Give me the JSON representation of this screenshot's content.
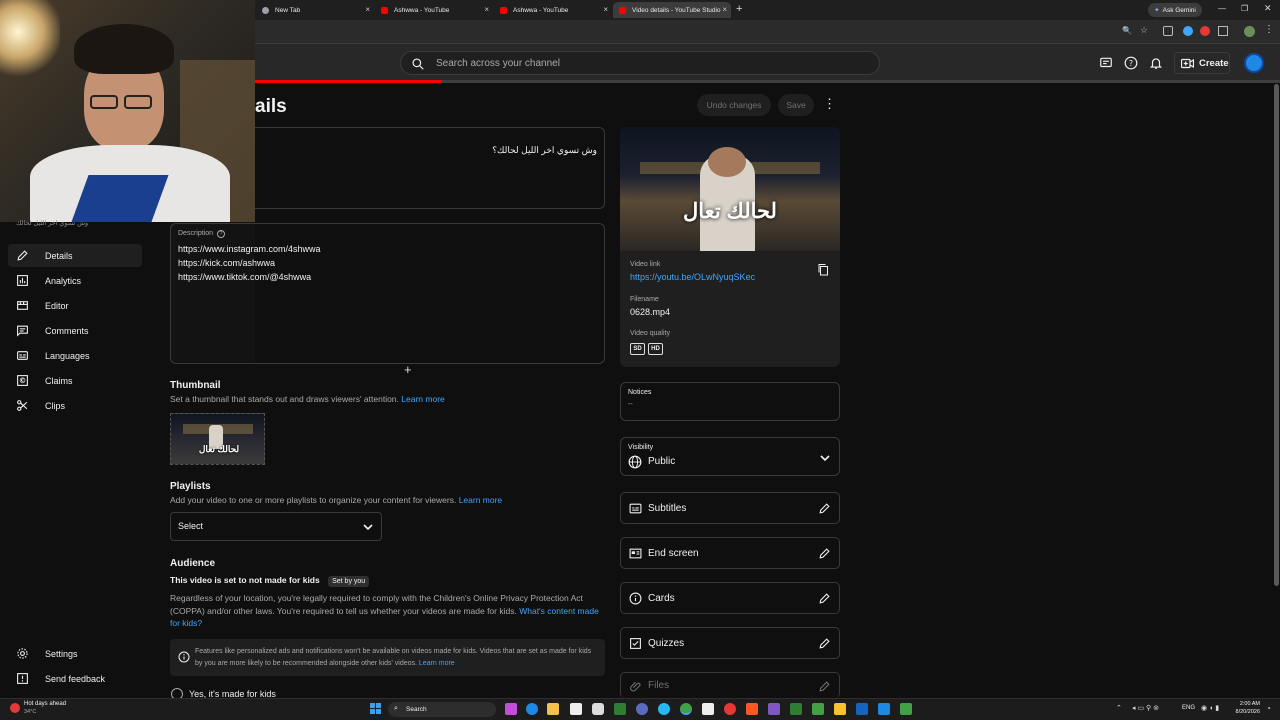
{
  "browser": {
    "tabs": [
      {
        "label": "New Tab",
        "favicon_color": "#9aa0a6"
      },
      {
        "label": "Ashwwa - YouTube",
        "favicon_color": "#ff0000"
      },
      {
        "label": "Ashwwa - YouTube",
        "favicon_color": "#ff0000"
      },
      {
        "label": "Video details - YouTube Studio",
        "favicon_color": "#ff0000"
      }
    ],
    "ask_gemini": "Ask Gemini"
  },
  "header": {
    "search_placeholder": "Search across your channel",
    "create_label": "Create"
  },
  "page": {
    "title": "ails",
    "undo_label": "Undo changes",
    "save_label": "Save"
  },
  "video": {
    "title_value": "وش تسوي اخر الليل لحالك؟",
    "title_label_faded": "وش تسوي اخر الليل لحالك",
    "description_label": "Description",
    "description_lines": [
      "https://www.instagram.com/4shwwa",
      "https://kick.com/ashwwa",
      "https://www.tiktok.com/@4shwwa"
    ],
    "thumbnail_overlay": "لحالك تعال"
  },
  "thumbnail": {
    "heading": "Thumbnail",
    "help": "Set a thumbnail that stands out and draws viewers' attention.",
    "learn_more": "Learn more"
  },
  "playlists": {
    "heading": "Playlists",
    "help": "Add your video to one or more playlists to organize your content for viewers.",
    "learn_more": "Learn more",
    "select_value": "Select"
  },
  "audience": {
    "heading": "Audience",
    "status": "This video is set to not made for kids",
    "set_by": "Set by you",
    "body": "Regardless of your location, you're legally required to comply with the Children's Online Privacy Protection Act (COPPA) and/or other laws. You're required to tell us whether your videos are made for kids.",
    "whats_content": "What's content made for kids?",
    "notice": "Features like personalized ads and notifications won't be available on videos made for kids. Videos that are set as made for kids by you are more likely to be recommended alongside other kids' videos.",
    "notice_link": "Learn more",
    "option_yes": "Yes, it's made for kids"
  },
  "sidebar": {
    "items": [
      {
        "label": "Details",
        "icon": "pencil-icon"
      },
      {
        "label": "Analytics",
        "icon": "analytics-icon"
      },
      {
        "label": "Editor",
        "icon": "editor-icon"
      },
      {
        "label": "Comments",
        "icon": "comments-icon"
      },
      {
        "label": "Languages",
        "icon": "languages-icon"
      },
      {
        "label": "Claims",
        "icon": "claims-icon"
      },
      {
        "label": "Clips",
        "icon": "scissors-icon"
      }
    ],
    "settings": "Settings",
    "feedback": "Send feedback"
  },
  "preview": {
    "video_link_label": "Video link",
    "video_link": "https://youtu.be/OLwNyuqSKec",
    "filename_label": "Filename",
    "filename": "0628.mp4",
    "quality_label": "Video quality",
    "badge_sd": "SD",
    "badge_hd": "HD"
  },
  "notices": {
    "label": "Notices",
    "value": "--"
  },
  "visibility": {
    "label": "Visibility",
    "value": "Public"
  },
  "side_rows": [
    {
      "label": "Subtitles",
      "icon": "subtitles-icon"
    },
    {
      "label": "End screen",
      "icon": "end-screen-icon"
    },
    {
      "label": "Cards",
      "icon": "cards-icon"
    },
    {
      "label": "Quizzes",
      "icon": "quizzes-icon"
    },
    {
      "label": "Files",
      "icon": "files-icon"
    }
  ],
  "taskbar": {
    "weather_title": "Hot days ahead",
    "weather_temp": "34°C",
    "search": "Search",
    "lang": "ENG",
    "time": "2:00 AM",
    "date": "8/20/2026"
  },
  "colors": {
    "accent": "#3ea6ff",
    "bg": "#0f0f0f",
    "brand": "#ff0000"
  }
}
